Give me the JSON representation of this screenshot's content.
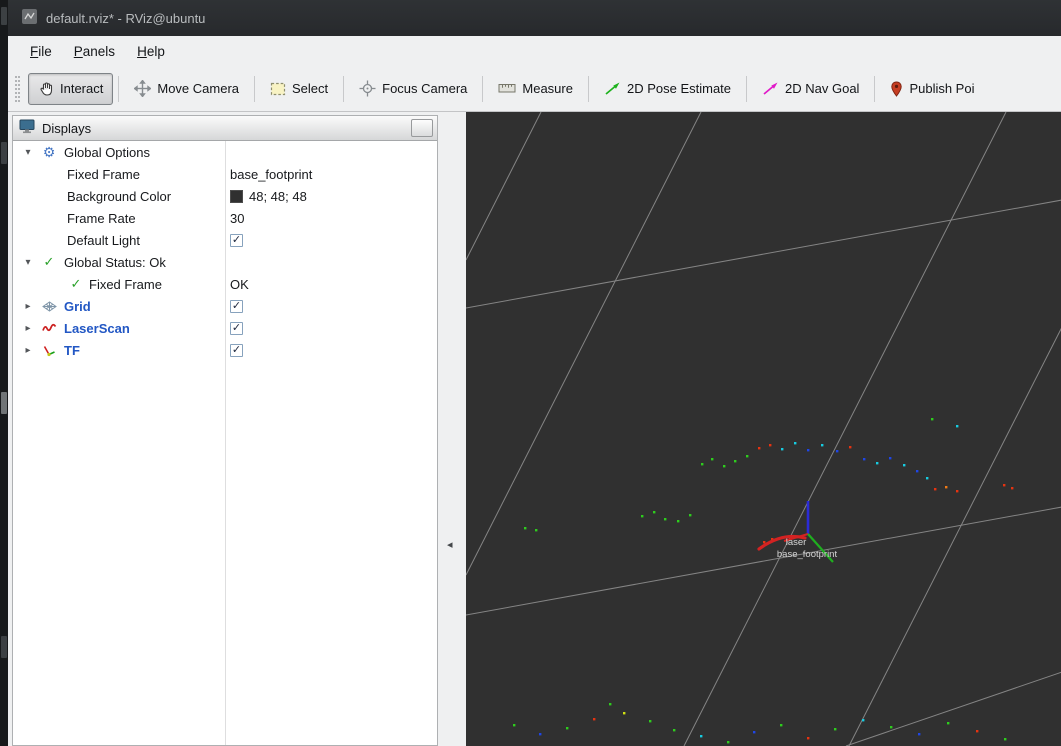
{
  "window": {
    "title": "default.rviz* - RViz@ubuntu"
  },
  "glyphs": {
    "expanded": "▾",
    "collapsed": "▸",
    "check": "✓",
    "gear": "⚙",
    "collapse_arrow": "◂"
  },
  "menu": {
    "items": [
      {
        "label": "File"
      },
      {
        "label": "Panels"
      },
      {
        "label": "Help"
      }
    ]
  },
  "toolbar": {
    "tools": [
      {
        "label": "Interact",
        "icon": "hand-icon",
        "active": true
      },
      {
        "label": "Move Camera",
        "icon": "move-camera-icon",
        "active": false
      },
      {
        "label": "Select",
        "icon": "select-box-icon",
        "active": false
      },
      {
        "label": "Focus Camera",
        "icon": "focus-crosshair-icon",
        "active": false
      },
      {
        "label": "Measure",
        "icon": "ruler-icon",
        "active": false
      },
      {
        "label": "2D Pose Estimate",
        "icon": "pose-arrow-icon",
        "active": false
      },
      {
        "label": "2D Nav Goal",
        "icon": "nav-goal-arrow-icon",
        "active": false
      },
      {
        "label": "Publish Poi",
        "icon": "publish-point-pin-icon",
        "active": false
      }
    ]
  },
  "displays": {
    "title": "Displays",
    "display_name_color": "#2257c4",
    "rows": [
      {
        "name": "Global Options",
        "value": ""
      },
      {
        "name": "Fixed Frame",
        "value": "base_footprint"
      },
      {
        "name": "Background Color",
        "value": "48; 48; 48",
        "swatch_color": "#303030"
      },
      {
        "name": "Frame Rate",
        "value": "30"
      },
      {
        "name": "Default Light",
        "checked": true
      },
      {
        "name": "Global Status: Ok",
        "value": ""
      },
      {
        "name": "Fixed Frame",
        "value": "OK"
      },
      {
        "name": "Grid",
        "checked": true
      },
      {
        "name": "LaserScan",
        "checked": true
      },
      {
        "name": "TF",
        "checked": true
      }
    ]
  },
  "viewport": {
    "background_color": "#303030",
    "grid_color": "#9a9a9a",
    "scan_arc_color": "#d32222",
    "axes": {
      "x": "#d32222",
      "y": "#1fae1f",
      "z": "#2b2bd6"
    },
    "frame_labels": {
      "laser": "laser",
      "base_footprint": "base_footprint"
    },
    "point_colors": {
      "g": "#2ecc1e",
      "r": "#e63311",
      "b": "#1f46e6",
      "c": "#17cbe0",
      "y": "#d0e012",
      "o": "#f07a16"
    },
    "grid_lines": [
      [
        0,
        196,
        596,
        88
      ],
      [
        0,
        503,
        596,
        395
      ],
      [
        380,
        634,
        596,
        560
      ],
      [
        75,
        0,
        0,
        148
      ],
      [
        235,
        0,
        0,
        463
      ],
      [
        540,
        0,
        218,
        634
      ],
      [
        596,
        215,
        383,
        634
      ]
    ],
    "scan_points": [
      [
        235,
        351,
        "g"
      ],
      [
        245,
        346,
        "g"
      ],
      [
        257,
        353,
        "g"
      ],
      [
        268,
        348,
        "g"
      ],
      [
        280,
        343,
        "g"
      ],
      [
        292,
        335,
        "r"
      ],
      [
        303,
        332,
        "r"
      ],
      [
        315,
        336,
        "c"
      ],
      [
        328,
        330,
        "c"
      ],
      [
        341,
        337,
        "b"
      ],
      [
        355,
        332,
        "c"
      ],
      [
        370,
        338,
        "b"
      ],
      [
        383,
        334,
        "r"
      ],
      [
        397,
        346,
        "b"
      ],
      [
        410,
        350,
        "c"
      ],
      [
        423,
        345,
        "b"
      ],
      [
        437,
        352,
        "c"
      ],
      [
        450,
        358,
        "b"
      ],
      [
        460,
        365,
        "c"
      ],
      [
        468,
        376,
        "r"
      ],
      [
        479,
        374,
        "o"
      ],
      [
        490,
        378,
        "r"
      ],
      [
        537,
        372,
        "r"
      ],
      [
        545,
        375,
        "r"
      ],
      [
        465,
        306,
        "g"
      ],
      [
        490,
        313,
        "c"
      ],
      [
        175,
        403,
        "g"
      ],
      [
        187,
        399,
        "g"
      ],
      [
        198,
        406,
        "g"
      ],
      [
        211,
        408,
        "g"
      ],
      [
        223,
        402,
        "g"
      ],
      [
        58,
        415,
        "g"
      ],
      [
        69,
        417,
        "g"
      ],
      [
        297,
        429,
        "r"
      ],
      [
        305,
        426,
        "r"
      ],
      [
        329,
        424,
        "r"
      ],
      [
        47,
        612,
        "g"
      ],
      [
        73,
        621,
        "b"
      ],
      [
        100,
        615,
        "g"
      ],
      [
        127,
        606,
        "r"
      ],
      [
        143,
        591,
        "g"
      ],
      [
        157,
        600,
        "y"
      ],
      [
        183,
        608,
        "g"
      ],
      [
        207,
        617,
        "g"
      ],
      [
        234,
        623,
        "c"
      ],
      [
        261,
        629,
        "g"
      ],
      [
        287,
        619,
        "b"
      ],
      [
        314,
        612,
        "g"
      ],
      [
        341,
        625,
        "r"
      ],
      [
        368,
        616,
        "g"
      ],
      [
        396,
        607,
        "c"
      ],
      [
        424,
        614,
        "g"
      ],
      [
        452,
        621,
        "b"
      ],
      [
        481,
        610,
        "g"
      ],
      [
        510,
        618,
        "r"
      ],
      [
        538,
        626,
        "g"
      ]
    ]
  }
}
